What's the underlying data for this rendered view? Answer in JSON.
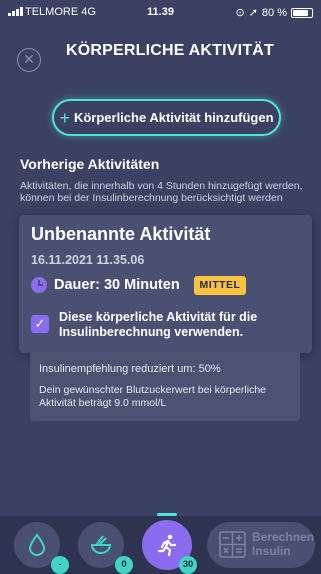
{
  "status_bar": {
    "carrier": "TELMORE",
    "network": "4G",
    "time": "11.39",
    "battery": "80 %"
  },
  "header": {
    "title": "KÖRPERLICHE AKTIVITÄT"
  },
  "add_button": {
    "label": "Körperliche Aktivität hinzufügen"
  },
  "previous": {
    "title": "Vorherige Aktivitäten",
    "description": "Aktivitäten, die innerhalb von 4 Stunden hinzugefügt werden, können bei der Insulinberechnung berücksichtigt werden"
  },
  "activity": {
    "name": "Unbenannte Aktivität",
    "datetime": "16.11.2021 11.35.06",
    "duration": "Dauer: 30 Minuten",
    "intensity": "MITTEL",
    "include_label": "Diese körperliche Aktivität für die Insulinberechnung verwenden.",
    "include_checked": true
  },
  "insulin_info": {
    "reduction": "Insulinempfehlung reduziert um: 50%",
    "target": "Dein gewünschter Blutzuckerwert bei körperliche Aktivität beträgt 9.0 mmol/L"
  },
  "bottom_nav": {
    "drop_count": "-",
    "food_count": "0",
    "activity_count": "30",
    "calculate_label": "Berechnen Insulin"
  },
  "colors": {
    "background": "#3b4162",
    "accent_teal": "#4fe3d6",
    "accent_purple": "#8b6cf0",
    "badge_yellow": "#f7c341"
  }
}
